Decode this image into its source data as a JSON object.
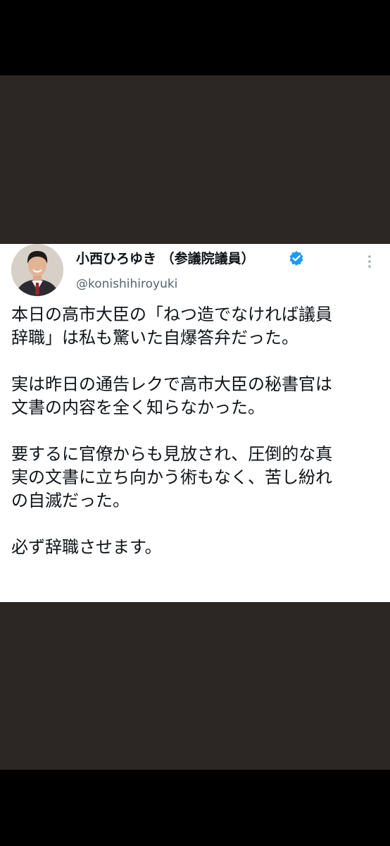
{
  "tweet": {
    "display_name": "小西ひろゆき （参議院議員）",
    "handle": "@konishihiroyuki",
    "verified_icon": "verified-badge-icon",
    "more_icon": "more-options-icon",
    "paragraphs": [
      "本日の高市大臣の「ねつ造でなければ議員\n辞職」は私も驚いた自爆答弁だった。",
      "実は昨日の通告レクで高市大臣の秘書官は\n文書の内容を全く知らなかった。",
      "要するに官僚からも見放され、圧倒的な真\n実の文書に立ち向かう術もなく、苦し紛れ\nの自滅だった。",
      "必ず辞職させます。"
    ]
  },
  "colors": {
    "outer_black": "#000000",
    "dark_band": "#2c2624",
    "card_bg": "#ffffff",
    "text": "#0f1419",
    "muted": "#536471",
    "verified": "#1d9bf0"
  }
}
